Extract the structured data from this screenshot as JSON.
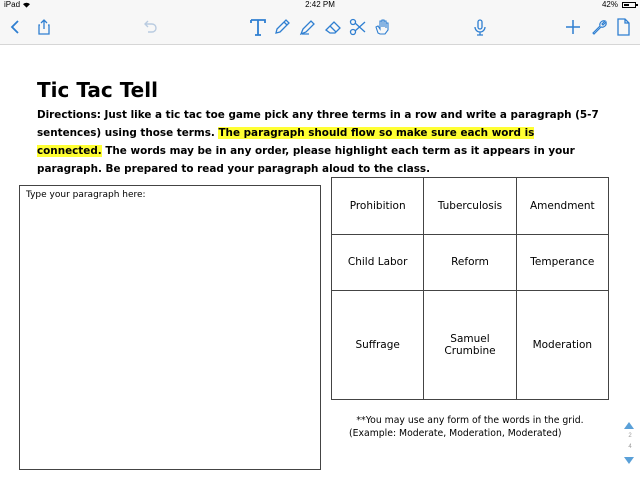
{
  "status_bar": {
    "device": "iPad",
    "time": "2:42 PM",
    "battery": "42%"
  },
  "toolbar": {
    "left": [
      "back-icon",
      "share-icon",
      "undo-icon"
    ],
    "tools": [
      "text-tool-icon",
      "pen-icon",
      "highlighter-icon",
      "eraser-icon",
      "scissors-icon",
      "hand-icon"
    ],
    "right": [
      "microphone-icon",
      "add-icon",
      "wrench-icon",
      "document-icon"
    ],
    "accent_color": "#2f7fd1"
  },
  "document": {
    "title": "Tic Tac Tell",
    "directions_part1": "Directions:  Just like a tic tac toe game pick any three terms in a row and write a paragraph (5-7 sentences) using those terms.  ",
    "directions_highlight": "The paragraph should flow so make sure each word is connected.",
    "directions_part2": "  The words may be in any order, please highlight each term as it appears in your paragraph.  Be prepared to read your paragraph aloud to the class.",
    "highlight_color": "#ffff33",
    "textbox_label": "Type your paragraph here:",
    "grid": [
      [
        "Prohibition",
        "Tuberculosis",
        "Amendment"
      ],
      [
        "Child Labor",
        "Reform",
        "Temperance"
      ],
      [
        "Suffrage",
        "Samuel Crumbine",
        "Moderation"
      ]
    ],
    "note_line1": "**You may use any form of the words in the grid.",
    "note_line2": "(Example:  Moderate, Moderation, Moderated)"
  },
  "page_indicator": {
    "current": "2",
    "total": "4"
  }
}
